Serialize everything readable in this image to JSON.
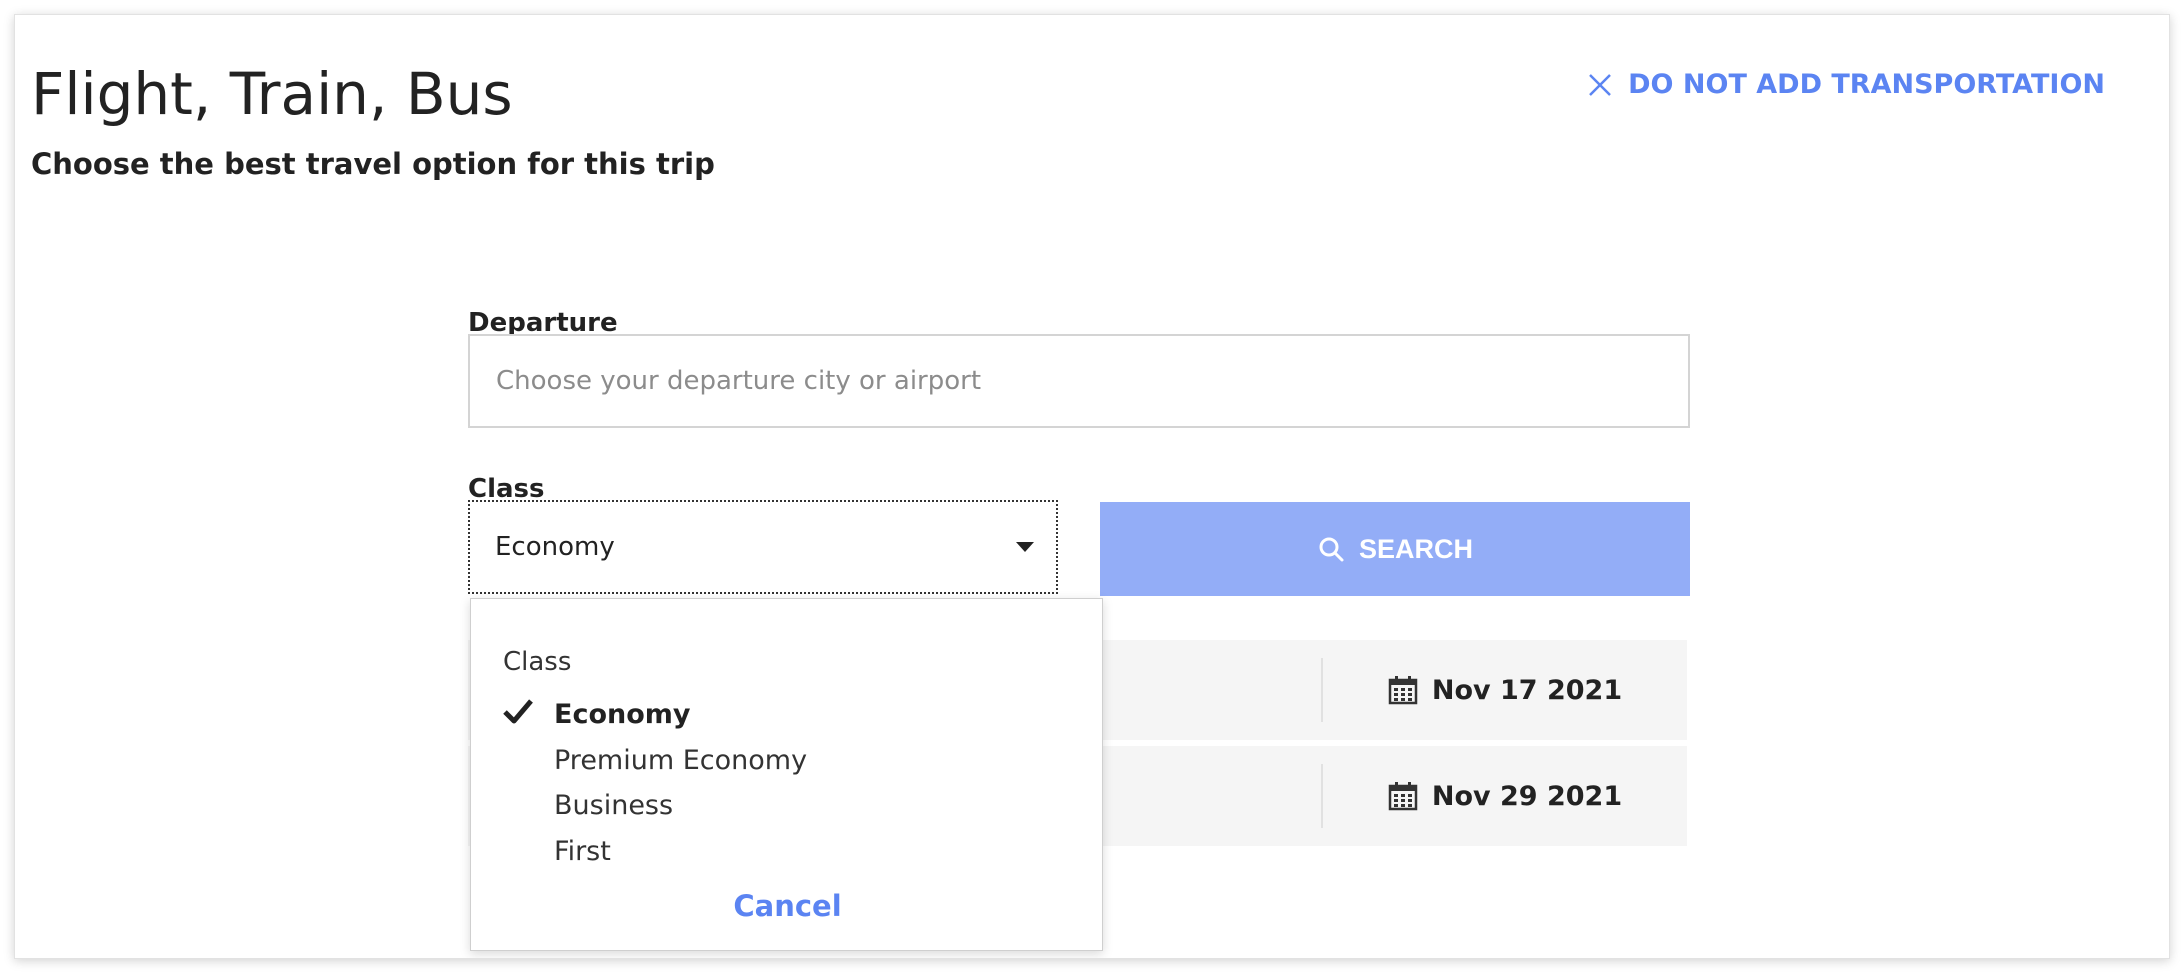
{
  "header": {
    "title": "Flight, Train, Bus",
    "subtitle": "Choose the best travel option for this trip",
    "dismiss_label": "DO NOT ADD TRANSPORTATION"
  },
  "form": {
    "departure_label": "Departure",
    "departure_value": "",
    "departure_placeholder": "Choose your departure city or airport",
    "class_label": "Class",
    "class_selected": "Economy",
    "search_label": "SEARCH"
  },
  "dates": [
    {
      "label": "Nov 17 2021"
    },
    {
      "label": "Nov 29 2021"
    }
  ],
  "dropdown": {
    "header": "Class",
    "options": [
      {
        "label": "Economy",
        "selected": true
      },
      {
        "label": "Premium Economy",
        "selected": false
      },
      {
        "label": "Business",
        "selected": false
      },
      {
        "label": "First",
        "selected": false
      }
    ],
    "cancel_label": "Cancel"
  },
  "colors": {
    "accent": "#5b84f2",
    "search_button_bg": "#93adf7",
    "row_bg": "#f5f5f5"
  },
  "icons": {
    "dismiss": "close-icon",
    "search": "search-icon",
    "date": "calendar-icon",
    "selected": "checkmark-icon",
    "select": "caret-down-icon"
  }
}
